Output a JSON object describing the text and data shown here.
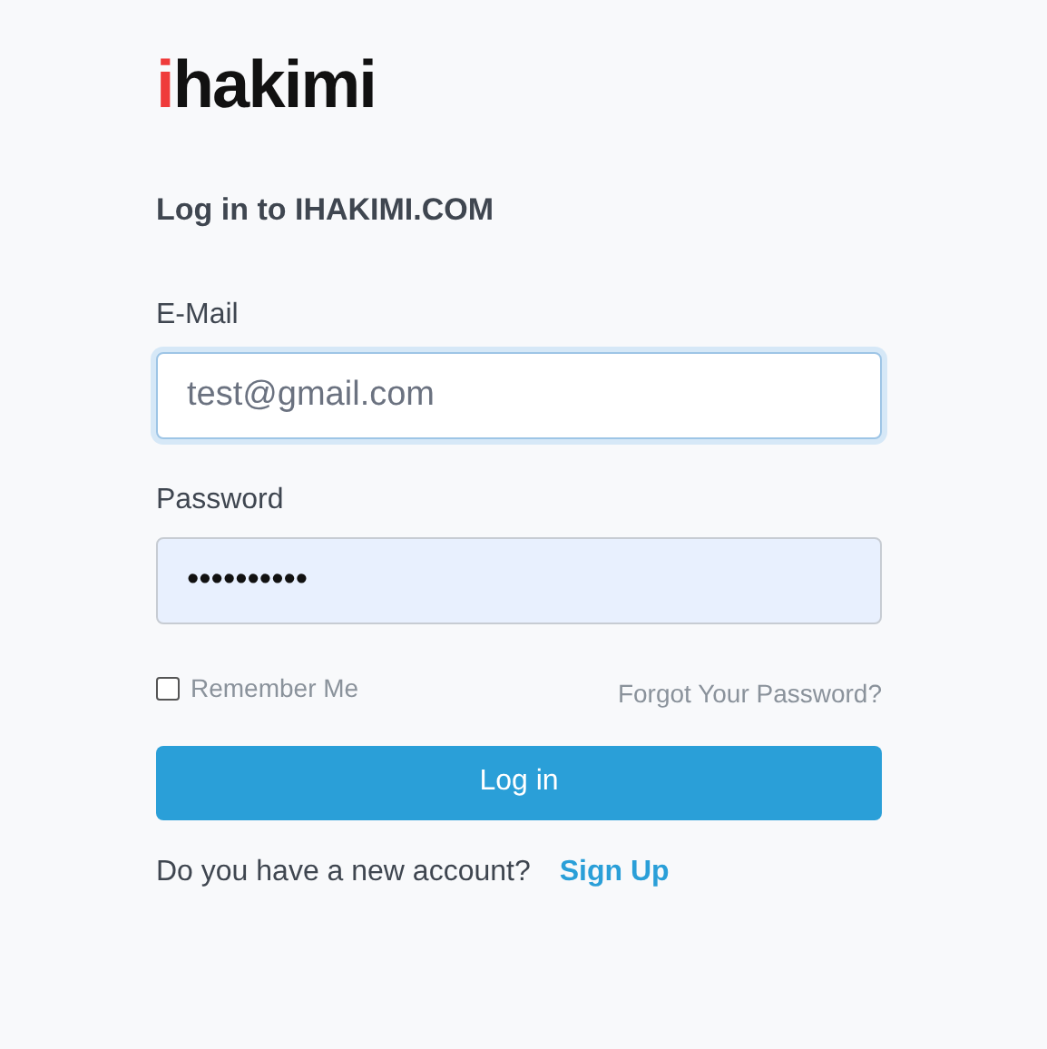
{
  "logo": {
    "accent": "i",
    "rest": "hakimi"
  },
  "heading": "Log in to IHAKIMI.COM",
  "fields": [
    {
      "label": "E-Mail",
      "value": "test@gmail.com",
      "focused": true,
      "autofilled": false
    },
    {
      "label": "Password",
      "value": "••••••••••",
      "focused": false,
      "autofilled": true
    }
  ],
  "remember": {
    "label": "Remember Me",
    "checked": false
  },
  "forgot_link": "Forgot Your Password?",
  "login_button": "Log in",
  "signup": {
    "prompt": "Do you have a new account?",
    "link": "Sign Up"
  }
}
